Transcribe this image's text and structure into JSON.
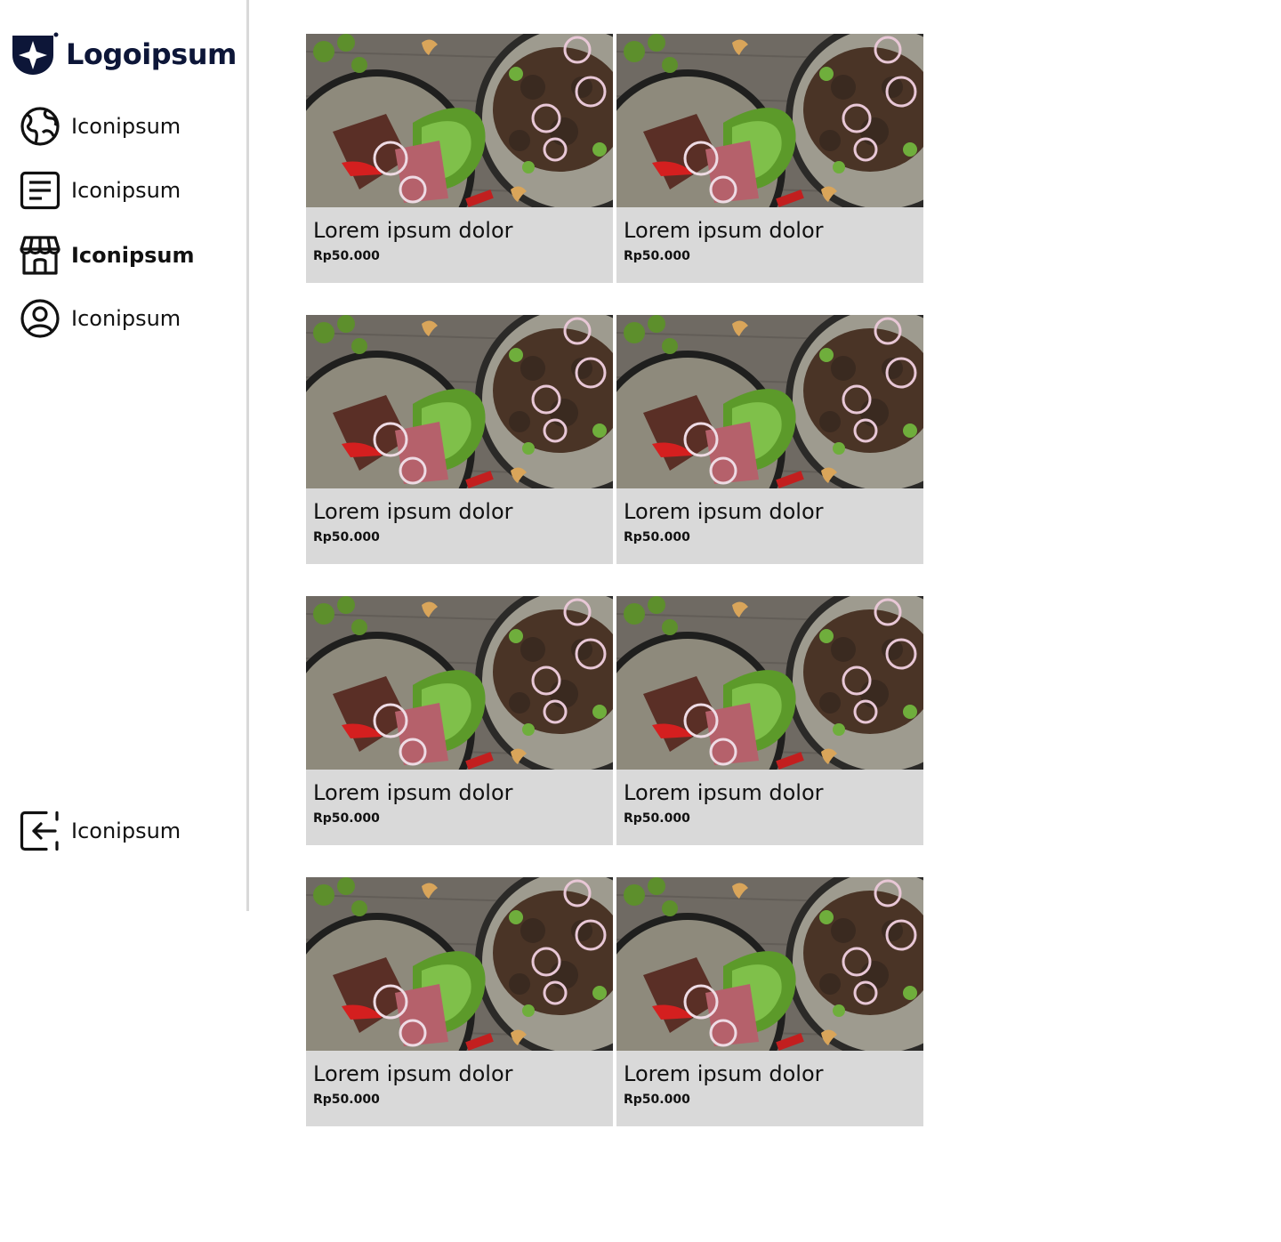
{
  "brand": {
    "name": "Logoipsum",
    "color": "#0d1638"
  },
  "sidebar": {
    "items": [
      {
        "label": "Iconipsum",
        "icon": "globe-icon",
        "active": false
      },
      {
        "label": "Iconipsum",
        "icon": "document-icon",
        "active": false
      },
      {
        "label": "Iconipsum",
        "icon": "store-icon",
        "active": true
      },
      {
        "label": "Iconipsum",
        "icon": "user-circle-icon",
        "active": false
      }
    ],
    "footer_item": {
      "label": "Iconipsum",
      "icon": "logout-icon"
    }
  },
  "products": [
    {
      "title": "Lorem ipsum dolor",
      "price": "Rp50.000",
      "image": "food-plate-image"
    },
    {
      "title": "Lorem ipsum dolor",
      "price": "Rp50.000",
      "image": "food-plate-image"
    },
    {
      "title": "Lorem ipsum dolor",
      "price": "Rp50.000",
      "image": "food-plate-image"
    },
    {
      "title": "Lorem ipsum dolor",
      "price": "Rp50.000",
      "image": "food-plate-image"
    },
    {
      "title": "Lorem ipsum dolor",
      "price": "Rp50.000",
      "image": "food-plate-image"
    },
    {
      "title": "Lorem ipsum dolor",
      "price": "Rp50.000",
      "image": "food-plate-image"
    },
    {
      "title": "Lorem ipsum dolor",
      "price": "Rp50.000",
      "image": "food-plate-image"
    },
    {
      "title": "Lorem ipsum dolor",
      "price": "Rp50.000",
      "image": "food-plate-image"
    }
  ],
  "colors": {
    "card_background": "#d9d9d9",
    "divider": "#d9d9d9"
  }
}
